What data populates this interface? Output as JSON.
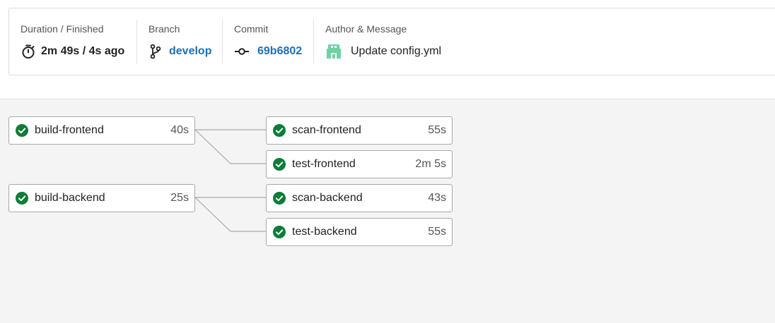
{
  "summary": {
    "duration": {
      "label": "Duration / Finished",
      "value": "2m 49s / 4s ago",
      "icon": "stopwatch-icon"
    },
    "branch": {
      "label": "Branch",
      "value": "develop",
      "icon": "git-branch-icon"
    },
    "commit": {
      "label": "Commit",
      "value": "69b6802",
      "icon": "git-commit-icon"
    },
    "author": {
      "label": "Author & Message",
      "message": "Update config.yml",
      "icon": "author-avatar"
    }
  },
  "workflow": {
    "status_color": "#0a7d36",
    "line_color": "#a9a9a9",
    "jobs": [
      {
        "id": "build-frontend",
        "name": "build-frontend",
        "duration": "40s",
        "status": "success"
      },
      {
        "id": "scan-frontend",
        "name": "scan-frontend",
        "duration": "55s",
        "status": "success"
      },
      {
        "id": "test-frontend",
        "name": "test-frontend",
        "duration": "2m 5s",
        "status": "success"
      },
      {
        "id": "build-backend",
        "name": "build-backend",
        "duration": "25s",
        "status": "success"
      },
      {
        "id": "scan-backend",
        "name": "scan-backend",
        "duration": "43s",
        "status": "success"
      },
      {
        "id": "test-backend",
        "name": "test-backend",
        "duration": "55s",
        "status": "success"
      }
    ],
    "edges": [
      [
        "build-frontend",
        "scan-frontend"
      ],
      [
        "build-frontend",
        "test-frontend"
      ],
      [
        "build-backend",
        "scan-backend"
      ],
      [
        "build-backend",
        "test-backend"
      ]
    ]
  }
}
